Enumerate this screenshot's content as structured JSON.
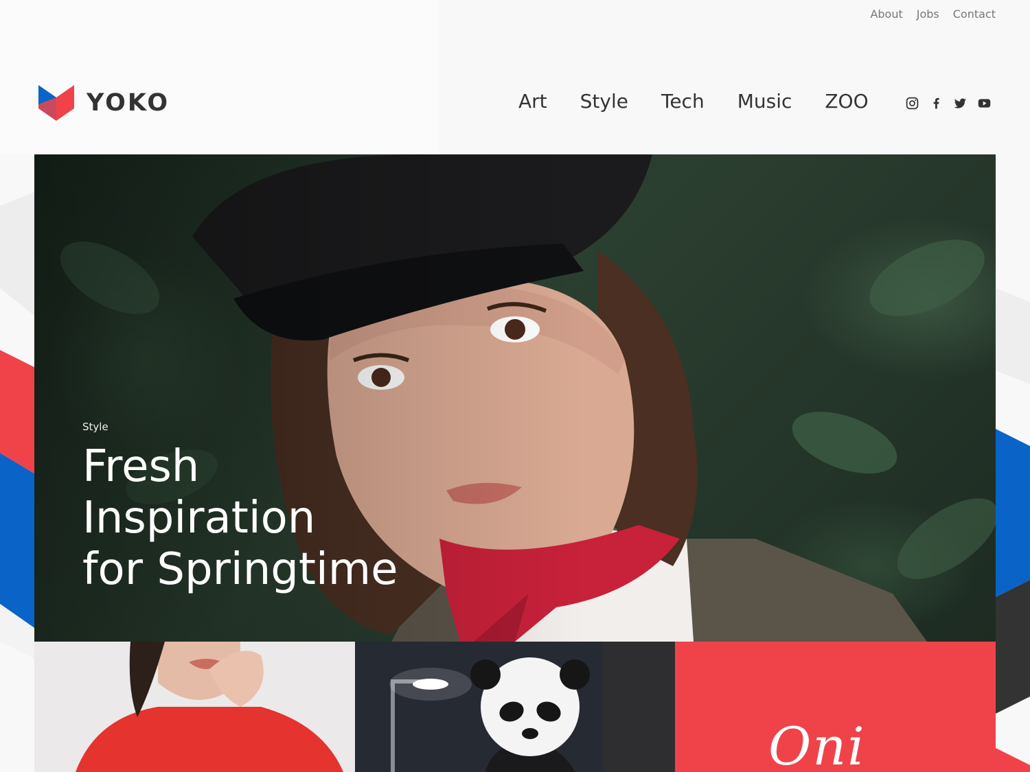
{
  "brand": {
    "name": "YOKO"
  },
  "top_nav": [
    {
      "label": "About"
    },
    {
      "label": "Jobs"
    },
    {
      "label": "Contact"
    }
  ],
  "main_nav": [
    {
      "label": "Art"
    },
    {
      "label": "Style"
    },
    {
      "label": "Tech"
    },
    {
      "label": "Music"
    },
    {
      "label": "ZOO"
    }
  ],
  "social_icons": [
    "instagram-icon",
    "facebook-icon",
    "twitter-icon",
    "youtube-icon"
  ],
  "hero": {
    "category": "Style",
    "title_lines": [
      "Fresh",
      "Inspiration",
      "for Springtime"
    ]
  },
  "tiles": [
    {
      "image": "woman-red-sweater-photo"
    },
    {
      "image": "panda-mask-photo"
    },
    {
      "script_text": "Oni"
    }
  ],
  "colors": {
    "accent_red": "#ef4349",
    "accent_blue": "#0a64c8",
    "dark": "#333333"
  }
}
